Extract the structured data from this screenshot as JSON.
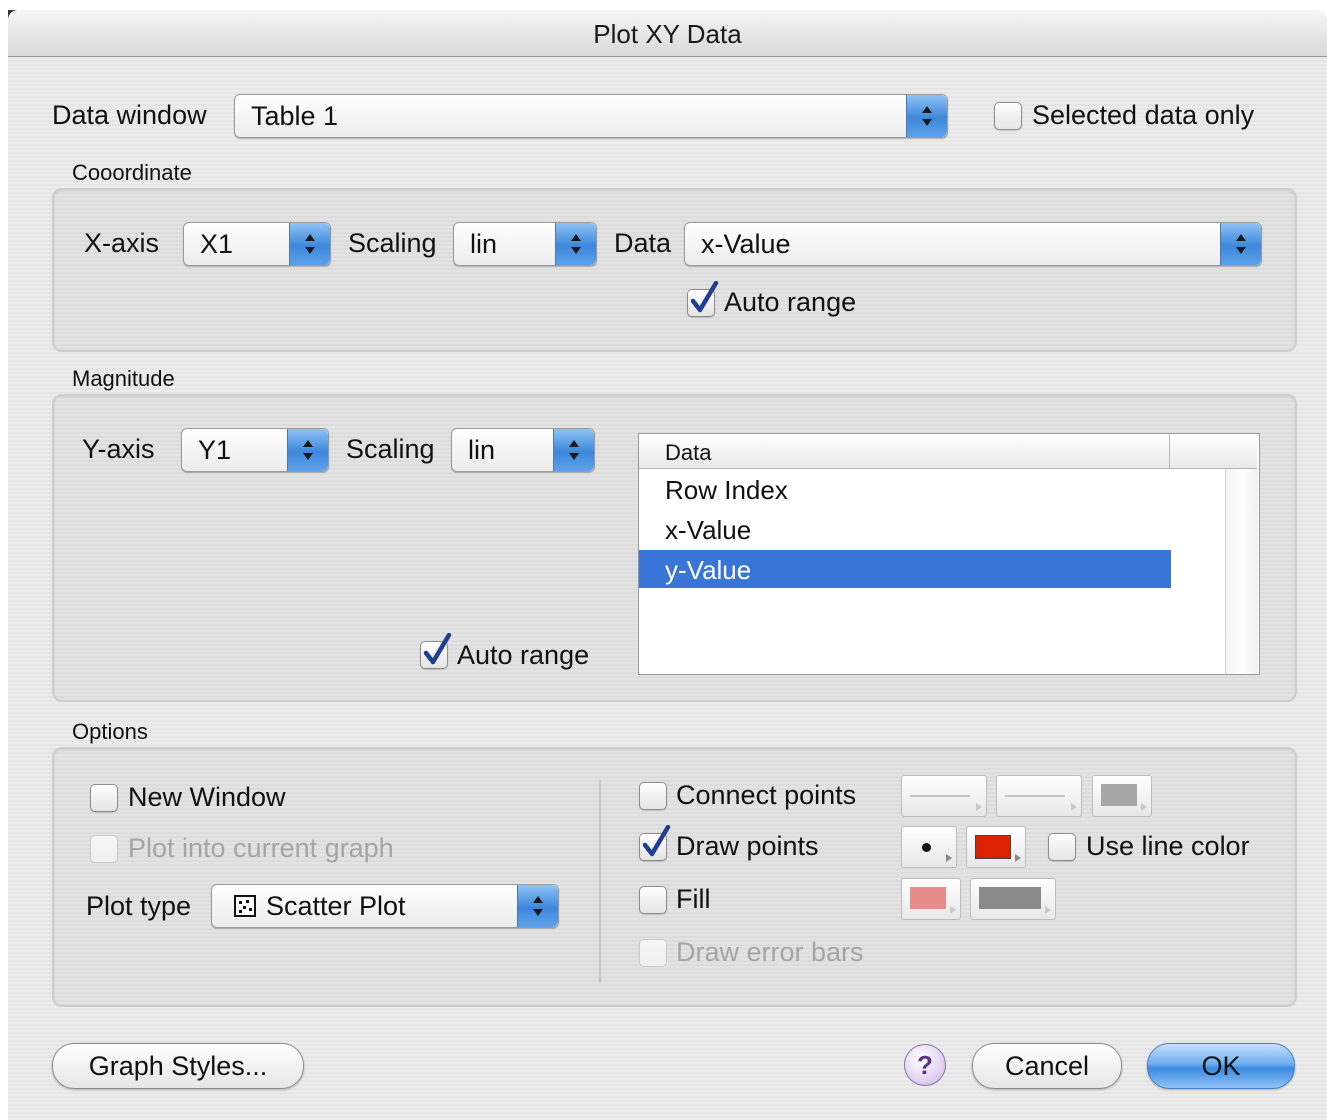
{
  "window": {
    "title": "Plot XY Data"
  },
  "top": {
    "data_window_label": "Data window",
    "data_window_value": "Table 1",
    "selected_only_label": "Selected data only",
    "selected_only_checked": false
  },
  "coordinate": {
    "section_label": "Cooordinate",
    "x_axis_label": "X-axis",
    "x_axis_value": "X1",
    "scaling_label": "Scaling",
    "scaling_value": "lin",
    "data_label": "Data",
    "data_value": "x-Value",
    "auto_range_label": "Auto range",
    "auto_range_checked": true
  },
  "magnitude": {
    "section_label": "Magnitude",
    "y_axis_label": "Y-axis",
    "y_axis_value": "Y1",
    "scaling_label": "Scaling",
    "scaling_value": "lin",
    "list_header": "Data",
    "list_items": [
      "Row Index",
      "x-Value",
      "y-Value"
    ],
    "selected_item": "y-Value",
    "auto_range_label": "Auto range",
    "auto_range_checked": true
  },
  "options": {
    "section_label": "Options",
    "new_window_label": "New Window",
    "new_window_checked": false,
    "plot_into_current_label": "Plot into current graph",
    "plot_into_current_enabled": false,
    "plot_type_label": "Plot type",
    "plot_type_value": "Scatter Plot",
    "connect_points_label": "Connect points",
    "connect_points_checked": false,
    "draw_points_label": "Draw points",
    "draw_points_checked": true,
    "use_line_color_label": "Use line color",
    "use_line_color_checked": false,
    "fill_label": "Fill",
    "fill_checked": false,
    "draw_error_bars_label": "Draw error bars",
    "draw_error_bars_enabled": false,
    "colors": {
      "point_color": "#dd2200",
      "fill_color": "#e88b8b",
      "fill_pattern": "#8a8a8a",
      "line_pattern": "#8a8a8a"
    }
  },
  "buttons": {
    "graph_styles": "Graph Styles...",
    "help": "?",
    "cancel": "Cancel",
    "ok": "OK"
  }
}
